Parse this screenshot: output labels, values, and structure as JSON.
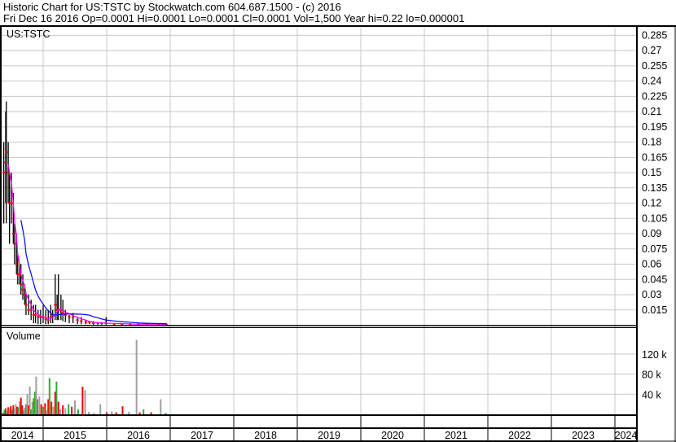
{
  "header": {
    "line1": "Historic Chart for US:TSTC by Stockwatch.com 604.687.1500 - (c) 2016",
    "line2": "Fri Dec 16 2016   Op=0.0001   Hi=0.0001   Lo=0.0001   Cl=0.0001   Vol=1,500   Year hi=0.22   lo=0.000001"
  },
  "chart_data": {
    "type": "candlestick",
    "symbol": "US:TSTC",
    "volume_label": "Volume",
    "price_ticks": [
      0.015,
      0.03,
      0.045,
      0.06,
      0.075,
      0.09,
      0.105,
      0.12,
      0.135,
      0.15,
      0.165,
      0.18,
      0.195,
      0.21,
      0.225,
      0.24,
      0.255,
      0.27,
      0.285
    ],
    "price_tick_labels": [
      "0.015",
      "0.03",
      "0.045",
      "0.06",
      "0.075",
      "0.09",
      "0.105",
      "0.12",
      "0.135",
      "0.15",
      "0.165",
      "0.18",
      "0.195",
      "0.21",
      "0.225",
      "0.24",
      "0.255",
      "0.27",
      "0.285"
    ],
    "ylim": [
      0,
      0.2925
    ],
    "volume_ticks": [
      40000,
      80000,
      120000
    ],
    "volume_tick_labels": [
      "40 k",
      "80 k",
      "120 k"
    ],
    "volume_ylim": [
      0,
      165000
    ],
    "years": [
      "2014",
      "2015",
      "2016",
      "2017",
      "2018",
      "2019",
      "2020",
      "2021",
      "2022",
      "2023",
      "2024"
    ],
    "xlim": [
      2014.35,
      2024.35
    ],
    "colors": {
      "bar": "#000000",
      "close": "#ff0000",
      "ma_short": "#ff00ff",
      "ma_long": "#0000ff",
      "vol_up": "#33aa33",
      "vol_down": "#ff0000",
      "vol_flat": "#a0a0a0",
      "grid": "#c8c8c8"
    },
    "bars": [
      [
        2014.38,
        0.18,
        0.1,
        0.15
      ],
      [
        2014.41,
        0.21,
        0.12,
        0.16
      ],
      [
        2014.42,
        0.22,
        0.1,
        0.17
      ],
      [
        2014.45,
        0.18,
        0.12,
        0.15
      ],
      [
        2014.47,
        0.15,
        0.08,
        0.12
      ],
      [
        2014.5,
        0.15,
        0.1,
        0.12
      ],
      [
        2014.53,
        0.13,
        0.08,
        0.09
      ],
      [
        2014.55,
        0.1,
        0.06,
        0.08
      ],
      [
        2014.58,
        0.09,
        0.05,
        0.06
      ],
      [
        2014.6,
        0.07,
        0.04,
        0.05
      ],
      [
        2014.63,
        0.06,
        0.04,
        0.05
      ],
      [
        2014.65,
        0.06,
        0.03,
        0.04
      ],
      [
        2014.68,
        0.05,
        0.025,
        0.035
      ],
      [
        2014.71,
        0.04,
        0.02,
        0.03
      ],
      [
        2014.73,
        0.03,
        0.01,
        0.02
      ],
      [
        2014.77,
        0.03,
        0.01,
        0.015
      ],
      [
        2014.81,
        0.025,
        0.005,
        0.015
      ],
      [
        2014.85,
        0.02,
        0.002,
        0.01
      ],
      [
        2014.88,
        0.02,
        0.002,
        0.01
      ],
      [
        2014.92,
        0.015,
        0.001,
        0.008
      ],
      [
        2014.96,
        0.015,
        0.001,
        0.008
      ],
      [
        2015.0,
        0.02,
        0.002,
        0.008
      ],
      [
        2015.04,
        0.015,
        0.001,
        0.006
      ],
      [
        2015.08,
        0.015,
        0.001,
        0.005
      ],
      [
        2015.12,
        0.02,
        0.002,
        0.008
      ],
      [
        2015.15,
        0.015,
        0.002,
        0.01
      ],
      [
        2015.19,
        0.05,
        0.005,
        0.02
      ],
      [
        2015.22,
        0.03,
        0.005,
        0.015
      ],
      [
        2015.24,
        0.05,
        0.005,
        0.015
      ],
      [
        2015.28,
        0.03,
        0.005,
        0.015
      ],
      [
        2015.31,
        0.025,
        0.004,
        0.012
      ],
      [
        2015.35,
        0.015,
        0.003,
        0.01
      ],
      [
        2015.41,
        0.01,
        0.002,
        0.008
      ],
      [
        2015.47,
        0.012,
        0.002,
        0.008
      ],
      [
        2015.54,
        0.008,
        0.001,
        0.005
      ],
      [
        2015.6,
        0.008,
        0.001,
        0.004
      ],
      [
        2015.67,
        0.005,
        0.001,
        0.003
      ],
      [
        2015.73,
        0.004,
        0.001,
        0.003
      ],
      [
        2015.79,
        0.004,
        0.0005,
        0.002
      ],
      [
        2015.86,
        0.003,
        0.0005,
        0.002
      ],
      [
        2015.92,
        0.003,
        0.0005,
        0.002
      ],
      [
        2015.99,
        0.008,
        0.0005,
        0.002
      ],
      [
        2016.12,
        0.002,
        0.0001,
        0.001
      ],
      [
        2016.24,
        0.002,
        0.0001,
        0.001
      ],
      [
        2016.37,
        0.002,
        0.0001,
        0.001
      ],
      [
        2016.5,
        0.002,
        0.0001,
        0.001
      ],
      [
        2016.63,
        0.002,
        0.0001,
        0.001
      ],
      [
        2016.82,
        0.002,
        0.0001,
        0.001
      ],
      [
        2016.95,
        0.001,
        0.0001,
        0.0001
      ]
    ],
    "volume": [
      [
        2014.37,
        3000,
        "d"
      ],
      [
        2014.39,
        9000,
        "u"
      ],
      [
        2014.41,
        12000,
        "d"
      ],
      [
        2014.43,
        6000,
        "f"
      ],
      [
        2014.45,
        14000,
        "d"
      ],
      [
        2014.47,
        10000,
        "f"
      ],
      [
        2014.49,
        16000,
        "d"
      ],
      [
        2014.51,
        8000,
        "u"
      ],
      [
        2014.53,
        18000,
        "d"
      ],
      [
        2014.55,
        12000,
        "f"
      ],
      [
        2014.57,
        20000,
        "f"
      ],
      [
        2014.59,
        15000,
        "d"
      ],
      [
        2014.61,
        14000,
        "u"
      ],
      [
        2014.63,
        26000,
        "f"
      ],
      [
        2014.65,
        33000,
        "d"
      ],
      [
        2014.67,
        18000,
        "d"
      ],
      [
        2014.69,
        8000,
        "u"
      ],
      [
        2014.71,
        13000,
        "f"
      ],
      [
        2014.73,
        20000,
        "u"
      ],
      [
        2014.75,
        40000,
        "f"
      ],
      [
        2014.77,
        18000,
        "d"
      ],
      [
        2014.79,
        55000,
        "f"
      ],
      [
        2014.81,
        10000,
        "u"
      ],
      [
        2014.83,
        25000,
        "f"
      ],
      [
        2014.85,
        32000,
        "u"
      ],
      [
        2014.87,
        45000,
        "u"
      ],
      [
        2014.89,
        75000,
        "f"
      ],
      [
        2014.91,
        30000,
        "u"
      ],
      [
        2014.94,
        35000,
        "f"
      ],
      [
        2014.97,
        20000,
        "d"
      ],
      [
        2015.0,
        15000,
        "u"
      ],
      [
        2015.03,
        22000,
        "d"
      ],
      [
        2015.05,
        8000,
        "f"
      ],
      [
        2015.08,
        30000,
        "d"
      ],
      [
        2015.1,
        72000,
        "u"
      ],
      [
        2015.13,
        25000,
        "d"
      ],
      [
        2015.16,
        15000,
        "f"
      ],
      [
        2015.19,
        45000,
        "d"
      ],
      [
        2015.21,
        65000,
        "u"
      ],
      [
        2015.24,
        25000,
        "d"
      ],
      [
        2015.27,
        10000,
        "f"
      ],
      [
        2015.31,
        18000,
        "d"
      ],
      [
        2015.35,
        12000,
        "f"
      ],
      [
        2015.4,
        20000,
        "u"
      ],
      [
        2015.45,
        15000,
        "d"
      ],
      [
        2015.5,
        28000,
        "f"
      ],
      [
        2015.55,
        10000,
        "u"
      ],
      [
        2015.62,
        55000,
        "d"
      ],
      [
        2015.66,
        48000,
        "f"
      ],
      [
        2015.72,
        5000,
        "f"
      ],
      [
        2015.8,
        3000,
        "f"
      ],
      [
        2015.9,
        20000,
        "f"
      ],
      [
        2016.0,
        4000,
        "d"
      ],
      [
        2016.08,
        6000,
        "f"
      ],
      [
        2016.15,
        4000,
        "d"
      ],
      [
        2016.25,
        16000,
        "d"
      ],
      [
        2016.35,
        5000,
        "f"
      ],
      [
        2016.47,
        148000,
        "f"
      ],
      [
        2016.52,
        4000,
        "d"
      ],
      [
        2016.58,
        10000,
        "u"
      ],
      [
        2016.7,
        4000,
        "d"
      ],
      [
        2016.85,
        30000,
        "f"
      ],
      [
        2016.93,
        3000,
        "u"
      ]
    ]
  }
}
